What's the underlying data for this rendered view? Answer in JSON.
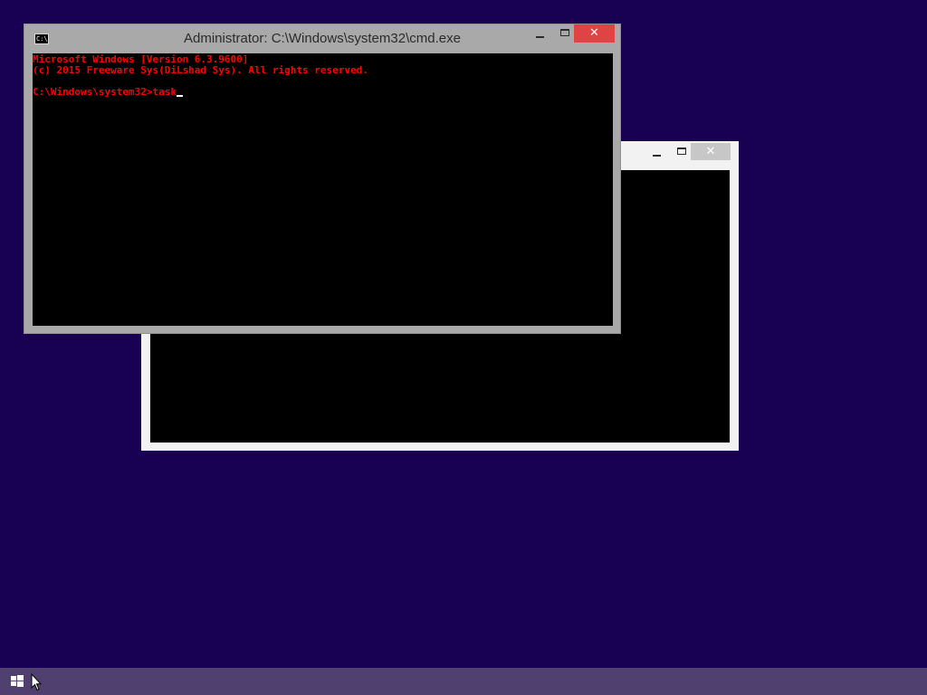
{
  "background_color": "#180052",
  "back_window": {
    "title": "",
    "minimize_icon": "minimize-icon",
    "maximize_icon": "maximize-icon",
    "close_glyph": "✕"
  },
  "front_window": {
    "title": "Administrator: C:\\Windows\\system32\\cmd.exe",
    "app_icon_text": "C:\\",
    "close_glyph": "✕",
    "console_lines": [
      "Microsoft Windows [Version 6.3.9600]",
      "(c) 2015 Freeware Sys(DiLshad Sys). All rights reserved.",
      "",
      "C:\\Windows\\system32>task"
    ],
    "text_color": "#ff0000"
  },
  "taskbar": {
    "start_icon": "windows-logo-icon",
    "color": "#4f406f"
  }
}
